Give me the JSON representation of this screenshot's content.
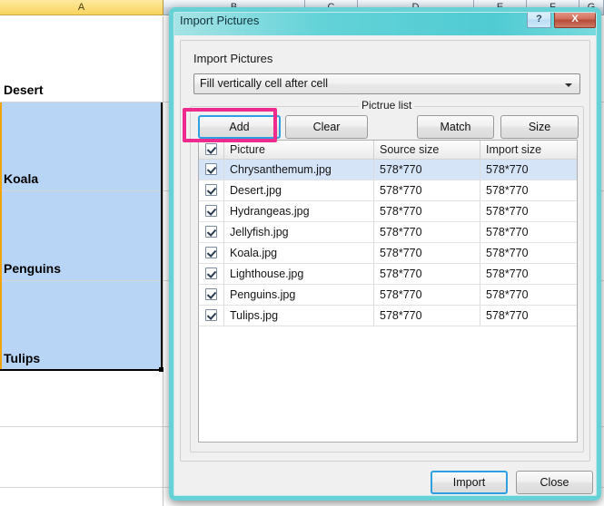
{
  "spreadsheet": {
    "column_headers": [
      "A",
      "B",
      "C",
      "D",
      "E",
      "F",
      "G"
    ],
    "selected_column": "A",
    "cells": [
      {
        "text": "Desert",
        "selected": false
      },
      {
        "text": "Koala",
        "selected": true
      },
      {
        "text": "Penguins",
        "selected": true
      },
      {
        "text": "Tulips",
        "selected": true
      }
    ]
  },
  "dialog": {
    "title": "Import Pictures",
    "help_button": "?",
    "close_button": "X",
    "section_label": "Import Pictures",
    "mode_combo": {
      "value": "Fill vertically cell after cell",
      "options": [
        "Fill vertically cell after cell"
      ]
    },
    "group_label": "Pictrue list",
    "buttons": {
      "add": "Add",
      "clear": "Clear",
      "match": "Match",
      "size": "Size"
    },
    "list": {
      "columns": [
        "Picture",
        "Source size",
        "Import size"
      ],
      "header_checkbox_checked": true,
      "rows": [
        {
          "checked": true,
          "picture": "Chrysanthemum.jpg",
          "source_size": "578*770",
          "import_size": "578*770",
          "selected": true
        },
        {
          "checked": true,
          "picture": "Desert.jpg",
          "source_size": "578*770",
          "import_size": "578*770",
          "selected": false
        },
        {
          "checked": true,
          "picture": "Hydrangeas.jpg",
          "source_size": "578*770",
          "import_size": "578*770",
          "selected": false
        },
        {
          "checked": true,
          "picture": "Jellyfish.jpg",
          "source_size": "578*770",
          "import_size": "578*770",
          "selected": false
        },
        {
          "checked": true,
          "picture": "Koala.jpg",
          "source_size": "578*770",
          "import_size": "578*770",
          "selected": false
        },
        {
          "checked": true,
          "picture": "Lighthouse.jpg",
          "source_size": "578*770",
          "import_size": "578*770",
          "selected": false
        },
        {
          "checked": true,
          "picture": "Penguins.jpg",
          "source_size": "578*770",
          "import_size": "578*770",
          "selected": false
        },
        {
          "checked": true,
          "picture": "Tulips.jpg",
          "source_size": "578*770",
          "import_size": "578*770",
          "selected": false
        }
      ]
    },
    "footer": {
      "import": "Import",
      "close": "Close"
    }
  },
  "annotation": {
    "highlight_target": "Add",
    "color": "#ee2a8e"
  },
  "colors": {
    "titlebar_teal": "#50cbd2",
    "dialog_border_teal": "#66d2d6",
    "excel_selection_fill": "#b8d5f5",
    "excel_column_header_selected": "#f8d35d",
    "focus_ring_blue": "#2e9fe0",
    "list_row_selected": "#d6e4f7",
    "annotation_magenta": "#ee2a8e"
  }
}
